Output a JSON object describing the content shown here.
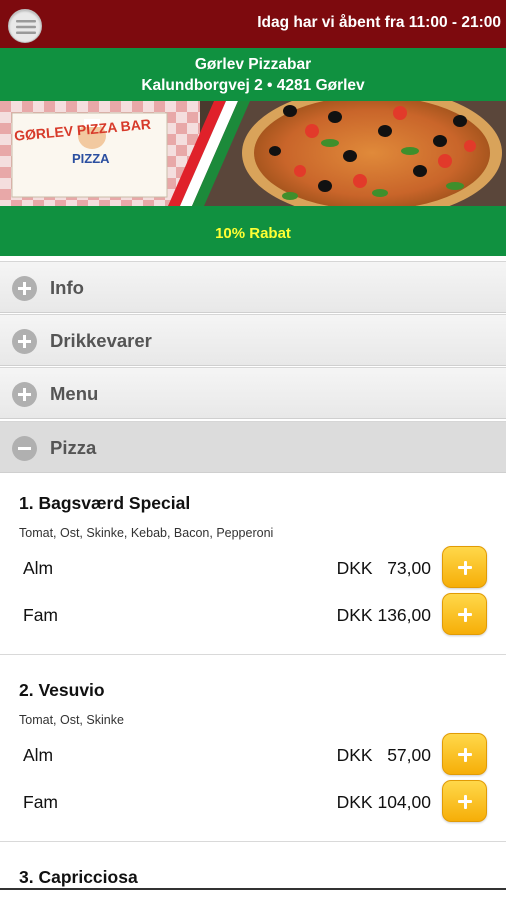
{
  "header": {
    "opening_text": "Idag har vi åbent fra 11:00 - 21:00",
    "restaurant_name": "Gørlev Pizzabar",
    "address": "Kalundborgvej 2 • 4281 Gørlev",
    "discount_text": "10% Rabat"
  },
  "banner": {
    "logo_text_top": "GØRLEV PIZZA BAR",
    "logo_text_bottom": "PIZZA"
  },
  "sections": [
    {
      "label": "Info",
      "state": "collapsed"
    },
    {
      "label": "Drikkevarer",
      "state": "collapsed"
    },
    {
      "label": "Menu",
      "state": "collapsed"
    },
    {
      "label": "Pizza",
      "state": "expanded"
    }
  ],
  "items": [
    {
      "title": "1. Bagsværd Special",
      "description": "Tomat, Ost, Skinke, Kebab, Bacon, Pepperoni",
      "sizes": [
        {
          "size": "Alm",
          "price": "DKK   73,00"
        },
        {
          "size": "Fam",
          "price": "DKK 136,00"
        }
      ]
    },
    {
      "title": "2. Vesuvio",
      "description": "Tomat, Ost, Skinke",
      "sizes": [
        {
          "size": "Alm",
          "price": "DKK   57,00"
        },
        {
          "size": "Fam",
          "price": "DKK 104,00"
        }
      ]
    },
    {
      "title": "3. Capricciosa"
    }
  ],
  "colors": {
    "topbar": "#7d0a0e",
    "green": "#109140",
    "discount_text": "#ffff33",
    "add_button": "#f6ae08"
  },
  "icons": {
    "menu": "hamburger-icon",
    "collapsed": "plus-circle-icon",
    "expanded": "minus-circle-icon",
    "add": "plus-icon"
  }
}
